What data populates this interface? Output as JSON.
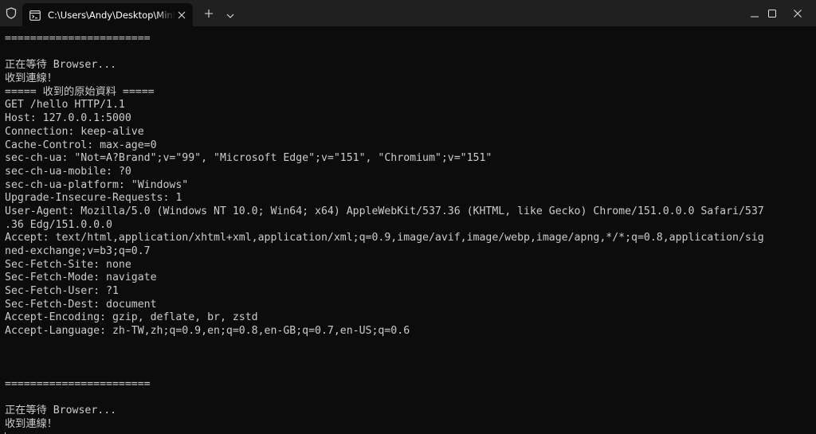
{
  "window": {
    "tab_title": "C:\\Users\\Andy\\Desktop\\MiniWebServer",
    "icons": {
      "shield": "shield-icon",
      "terminal": "terminal-icon",
      "close_tab": "close-icon",
      "new_tab": "plus-icon",
      "dropdown": "chevron-down-icon",
      "minimize": "minimize-icon",
      "maximize": "maximize-icon",
      "close": "close-icon"
    }
  },
  "terminal": {
    "lines": [
      "=======================",
      "",
      "正在等待 Browser...",
      "收到連線！",
      "===== 收到的原始資料 =====",
      "GET /hello HTTP/1.1",
      "Host: 127.0.0.1:5000",
      "Connection: keep-alive",
      "Cache-Control: max-age=0",
      "sec-ch-ua: \"Not=A?Brand\";v=\"99\", \"Microsoft Edge\";v=\"151\", \"Chromium\";v=\"151\"",
      "sec-ch-ua-mobile: ?0",
      "sec-ch-ua-platform: \"Windows\"",
      "Upgrade-Insecure-Requests: 1",
      "User-Agent: Mozilla/5.0 (Windows NT 10.0; Win64; x64) AppleWebKit/537.36 (KHTML, like Gecko) Chrome/151.0.0.0 Safari/537",
      ".36 Edg/151.0.0.0",
      "Accept: text/html,application/xhtml+xml,application/xml;q=0.9,image/avif,image/webp,image/apng,*/*;q=0.8,application/sig",
      "ned-exchange;v=b3;q=0.7",
      "Sec-Fetch-Site: none",
      "Sec-Fetch-Mode: navigate",
      "Sec-Fetch-User: ?1",
      "Sec-Fetch-Dest: document",
      "Accept-Encoding: gzip, deflate, br, zstd",
      "Accept-Language: zh-TW,zh;q=0.9,en;q=0.8,en-GB;q=0.7,en-US;q=0.6",
      "",
      "",
      "",
      "=======================",
      "",
      "正在等待 Browser...",
      "收到連線！"
    ]
  }
}
